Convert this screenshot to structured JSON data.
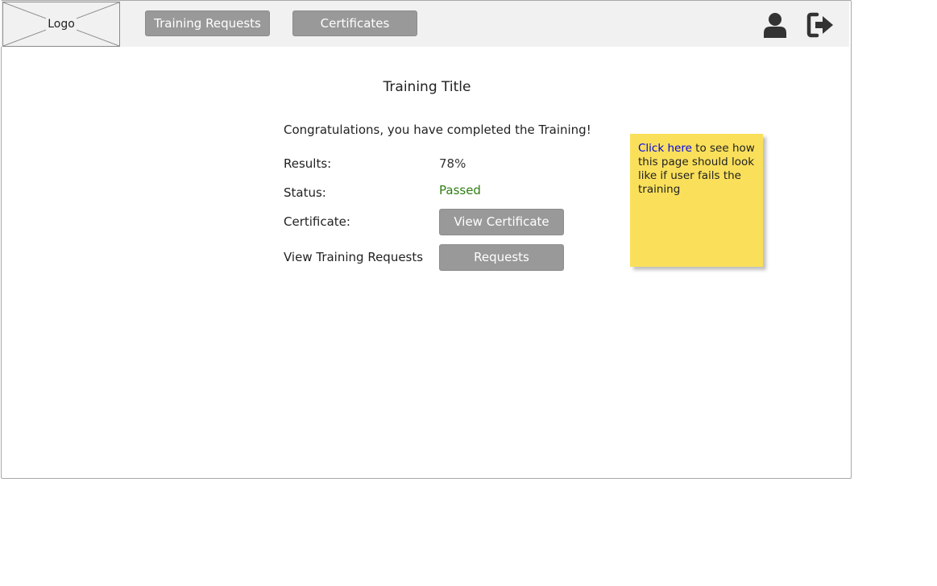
{
  "header": {
    "logo_label": "Logo",
    "nav": [
      {
        "label": "Training Requests"
      },
      {
        "label": "Certificates"
      }
    ],
    "icons": {
      "profile": "user-icon",
      "logout": "sign-out-icon"
    }
  },
  "main": {
    "title": "Training Title",
    "message": "Congratulations, you have completed the Training!",
    "rows": [
      {
        "label": "Results:",
        "value": "78%"
      },
      {
        "label": "Status:",
        "value": "Passed"
      },
      {
        "label": "Certificate:",
        "button": "View Certificate"
      },
      {
        "label": "View Training Requests",
        "button": "Requests"
      }
    ]
  },
  "sticky_note": {
    "link_text": "Click here",
    "text": " to see how this page should look like if user fails the training"
  },
  "colors": {
    "nav_button_bg": "#999999",
    "top_bar_bg": "#f1f1f1",
    "status_passed": "#2e7d12",
    "sticky_note_bg": "#fae05a",
    "link": "#0000ee"
  }
}
